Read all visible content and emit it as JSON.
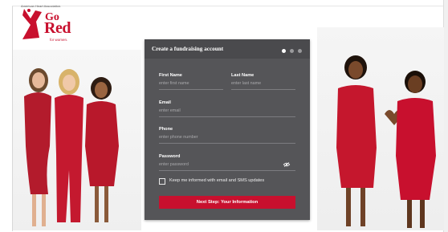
{
  "logo": {
    "org": "American Heart Association.",
    "go": "Go",
    "red": "Red",
    "tagline": "for women."
  },
  "form": {
    "title": "Create a fundraising account",
    "steps_total": 3,
    "current_step": 1,
    "fields": {
      "first_name": {
        "label": "First Name",
        "placeholder": "enter first name",
        "value": ""
      },
      "last_name": {
        "label": "Last Name",
        "placeholder": "enter last name",
        "value": ""
      },
      "email": {
        "label": "Email",
        "placeholder": "enter email",
        "value": ""
      },
      "phone": {
        "label": "Phone",
        "placeholder": "enter phone number",
        "value": ""
      },
      "password": {
        "label": "Password",
        "placeholder": "enter password",
        "value": ""
      }
    },
    "keep_informed_label": "Keep me informed with email and SMS updates",
    "keep_informed_checked": false,
    "submit_label": "Next Step: Your Information"
  },
  "colors": {
    "brand_red": "#c8102e",
    "panel_bg": "#555558",
    "panel_header": "#4a4a4d"
  },
  "icons": {
    "password_toggle": "eye-slash-icon"
  }
}
